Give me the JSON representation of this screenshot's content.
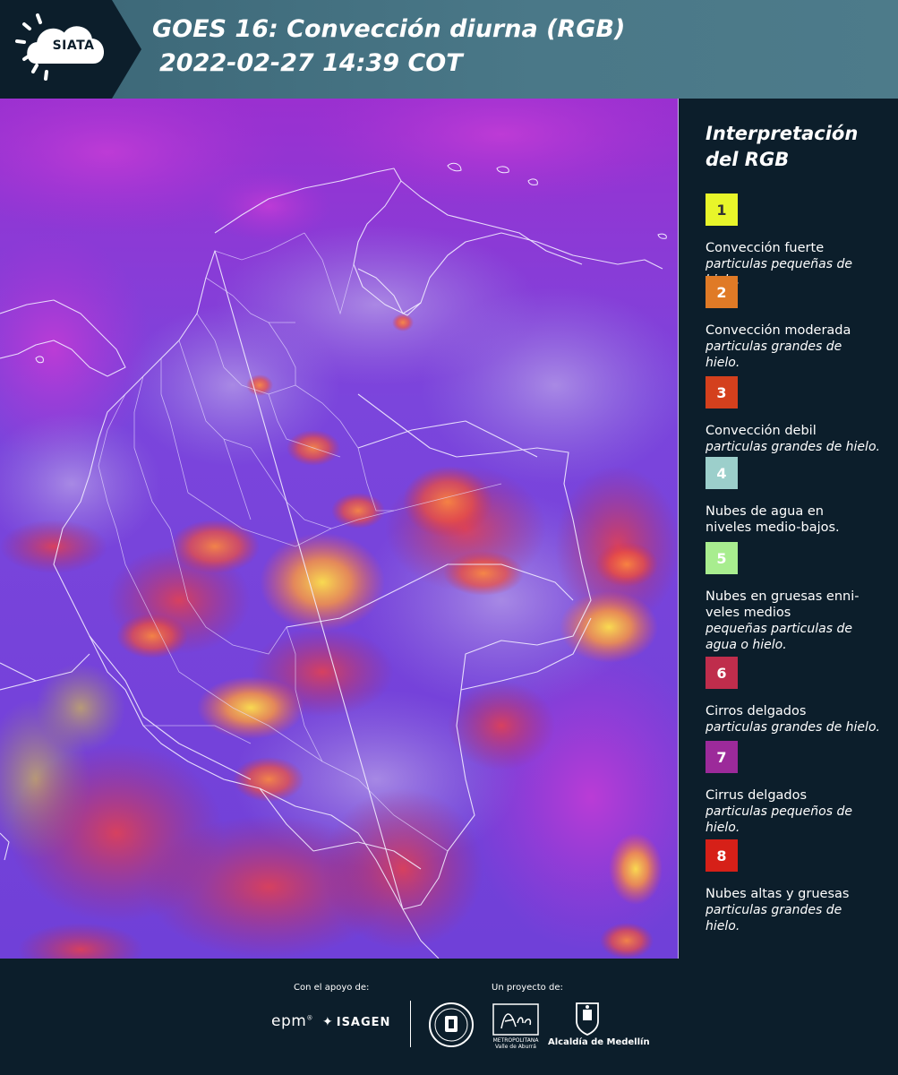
{
  "header": {
    "logo_text": "SIATA",
    "title_line1": "GOES 16: Convección diurna (RGB)",
    "title_line2": "2022-02-27 14:39 COT",
    "background_color": "#4a7888"
  },
  "legend": {
    "title_line1": "Interpretación",
    "title_line2": "del RGB",
    "items": [
      {
        "number": "1",
        "color": "#e8f52a",
        "text_color": "#333333",
        "name": "Convección fuerte",
        "desc": "particulas pequeñas de hielo."
      },
      {
        "number": "2",
        "color": "#e07a26",
        "text_color": "#ffffff",
        "name": "Convección moderada",
        "desc": "particulas grandes de hielo."
      },
      {
        "number": "3",
        "color": "#d4401d",
        "text_color": "#ffffff",
        "name": "Convección debil",
        "desc": "particulas grandes de hielo."
      },
      {
        "number": "4",
        "color": "#9ccfcb",
        "text_color": "#ffffff",
        "name": "Nubes de agua en niveles medio-bajos.",
        "desc": ""
      },
      {
        "number": "5",
        "color": "#a8ed8f",
        "text_color": "#ffffff",
        "name": "Nubes en gruesas enni-veles medios",
        "desc": "pequeñas particulas de agua o hielo."
      },
      {
        "number": "6",
        "color": "#bf2d4c",
        "text_color": "#ffffff",
        "name": "Cirros delgados",
        "desc": "particulas grandes de hielo."
      },
      {
        "number": "7",
        "color": "#9c2a9a",
        "text_color": "#ffffff",
        "name": "Cirrus delgados",
        "desc": "particulas pequeños de hielo."
      },
      {
        "number": "8",
        "color": "#d62018",
        "text_color": "#ffffff",
        "name": "Nubes altas y gruesas",
        "desc": "particulas grandes de hielo."
      }
    ]
  },
  "footer": {
    "support_label": "Con el apoyo de:",
    "project_label": "Un proyecto de:",
    "sponsor1": "epm",
    "sponsor2": "ISAGEN",
    "partner1_line1": "METROPOLITANA",
    "partner1_line2": "Valle de Aburrá",
    "partner2": "Alcaldía de Medellín"
  }
}
